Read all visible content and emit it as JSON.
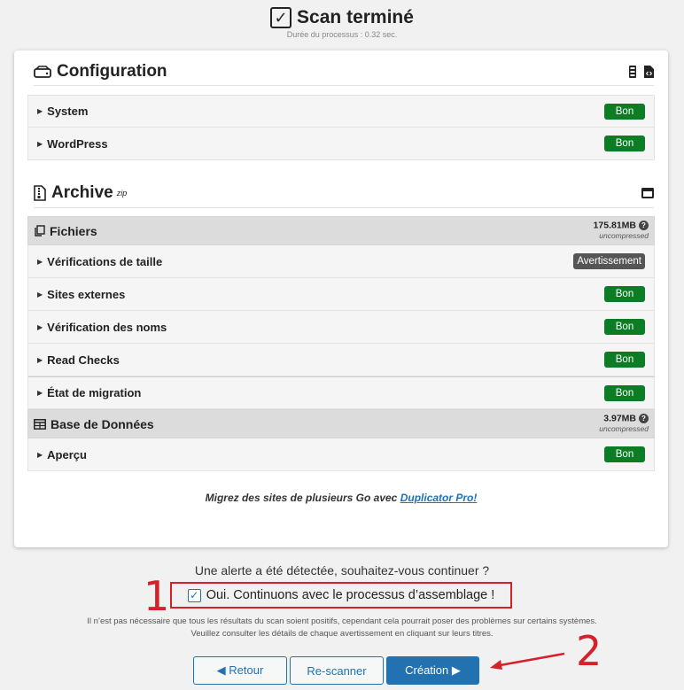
{
  "header": {
    "title": "Scan terminé",
    "duration": "Durée du processus : 0.32 sec."
  },
  "configuration": {
    "title": "Configuration",
    "rows": [
      {
        "label": "System",
        "status": "Bon"
      },
      {
        "label": "WordPress",
        "status": "Bon"
      }
    ]
  },
  "archive": {
    "title": "Archive",
    "format": "zip",
    "files": {
      "title": "Fichiers",
      "size": "175.81MB",
      "size_note": "uncompressed",
      "rows": [
        {
          "label": "Vérifications de taille",
          "status": "Avertissement"
        },
        {
          "label": "Sites externes",
          "status": "Bon"
        },
        {
          "label": "Vérification des noms",
          "status": "Bon"
        },
        {
          "label": "Read Checks",
          "status": "Bon"
        },
        {
          "label": "État de migration",
          "status": "Bon"
        }
      ]
    },
    "database": {
      "title": "Base de Données",
      "size": "3.97MB",
      "size_note": "uncompressed",
      "rows": [
        {
          "label": "Aperçu",
          "status": "Bon"
        }
      ]
    }
  },
  "promo": {
    "text": "Migrez des sites de plusieurs Go avec ",
    "link": "Duplicator Pro!"
  },
  "alert": {
    "question": "Une alerte a été détectée, souhaitez-vous continuer ?",
    "confirm_label": "Oui. Continuons avec le processus d’assemblage !",
    "note_line1": "Il n’est pas nécessaire que tous les résultats du scan soient positifs, cependant cela pourrait poser des problèmes sur certains systèmes.",
    "note_line2": "Veuillez consulter les détails de chaque avertissement en cliquant sur leurs titres."
  },
  "buttons": {
    "back": "◀ Retour",
    "rescan": "Re-scanner",
    "create": "Création ▶"
  },
  "annotations": {
    "one": "1",
    "two": "2"
  },
  "colors": {
    "ok": "#0c7d24",
    "warn": "#555555",
    "accent": "#2271b1",
    "annotation": "#d6202a"
  }
}
